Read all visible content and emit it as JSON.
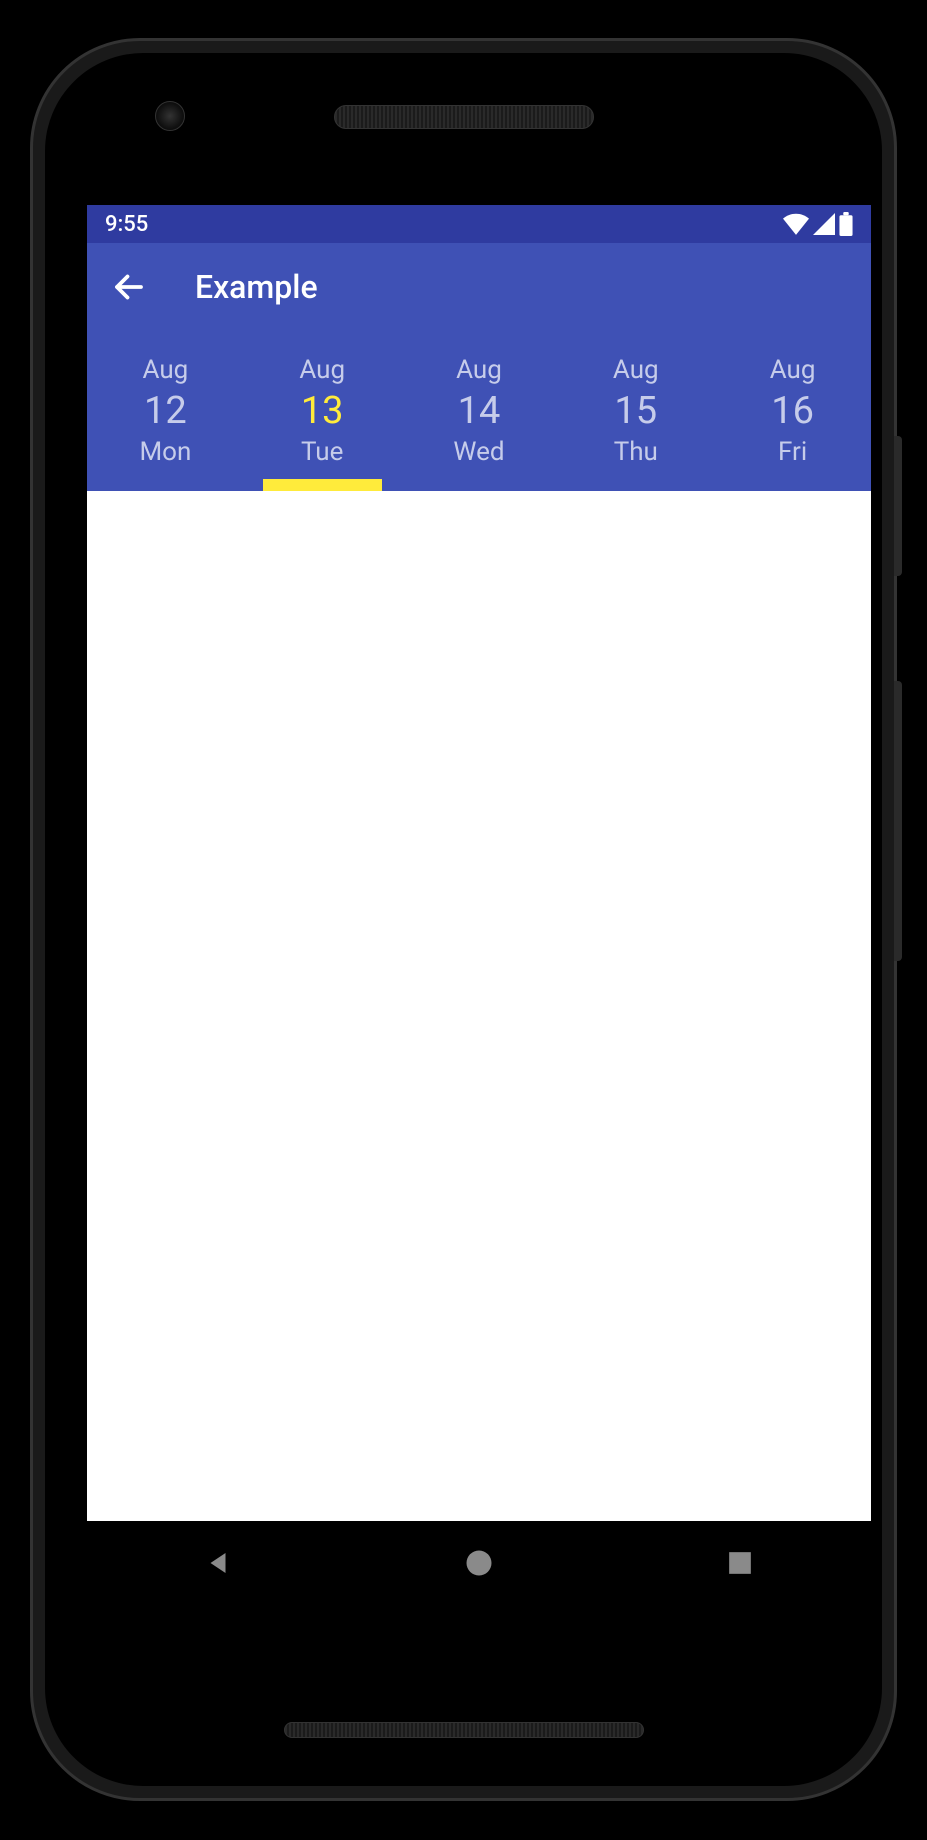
{
  "status_bar": {
    "time": "9:55",
    "icons": {
      "wifi": "wifi-icon",
      "signal": "signal-icon",
      "battery": "battery-icon"
    }
  },
  "app_bar": {
    "title": "Example",
    "back_icon": "back-arrow-icon"
  },
  "date_tabs": {
    "selected_index": 1,
    "items": [
      {
        "month": "Aug",
        "day_num": "12",
        "day_name": "Mon"
      },
      {
        "month": "Aug",
        "day_num": "13",
        "day_name": "Tue"
      },
      {
        "month": "Aug",
        "day_num": "14",
        "day_name": "Wed"
      },
      {
        "month": "Aug",
        "day_num": "15",
        "day_name": "Thu"
      },
      {
        "month": "Aug",
        "day_num": "16",
        "day_name": "Fri"
      }
    ]
  },
  "nav_bar": {
    "back": "nav-back-icon",
    "home": "nav-home-icon",
    "recent": "nav-recent-icon"
  },
  "colors": {
    "primary": "#3F51B5",
    "primary_dark": "#2F3BA0",
    "accent": "#FFEB3B",
    "tab_text": "#C6CCEA"
  }
}
